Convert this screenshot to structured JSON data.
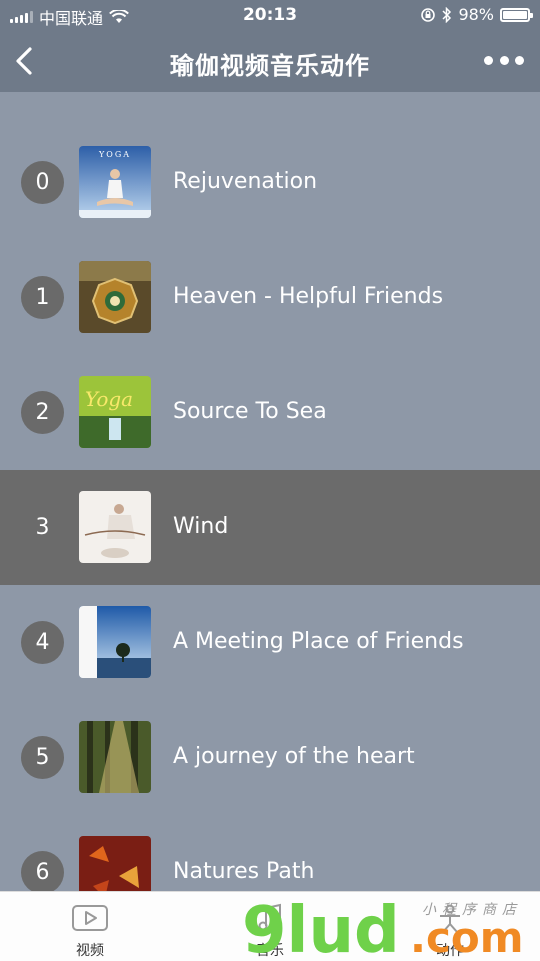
{
  "status_bar": {
    "carrier": "中国联通",
    "time": "20:13",
    "battery": "98%",
    "battery_level": 0.98
  },
  "nav": {
    "title": "瑜伽视频音乐动作"
  },
  "tracks": [
    {
      "index": "0",
      "title": "Rejuvenation",
      "cover_text": "YOGA"
    },
    {
      "index": "1",
      "title": "Heaven - Helpful Friends",
      "cover_text": ""
    },
    {
      "index": "2",
      "title": "Source To Sea",
      "cover_text": "Yoga"
    },
    {
      "index": "3",
      "title": "Wind",
      "cover_text": ""
    },
    {
      "index": "4",
      "title": "A Meeting Place of Friends",
      "cover_text": ""
    },
    {
      "index": "5",
      "title": "A journey of the heart",
      "cover_text": ""
    },
    {
      "index": "6",
      "title": "Natures Path",
      "cover_text": ""
    }
  ],
  "active_track": 3,
  "tabs": [
    {
      "label": "视频",
      "icon": "video-icon"
    },
    {
      "label": "音乐",
      "icon": "music-icon"
    },
    {
      "label": "动作",
      "icon": "action-icon"
    }
  ],
  "watermark": {
    "brand": "9lud",
    "suffix": ".com",
    "tagline": "小程序商店"
  },
  "colors": {
    "nav_bg": "#6f7a89",
    "list_bg": "#8e98a7",
    "active_row": "#6b6b6b",
    "watermark_green": "#6fd14a",
    "watermark_orange": "#f08a24"
  }
}
